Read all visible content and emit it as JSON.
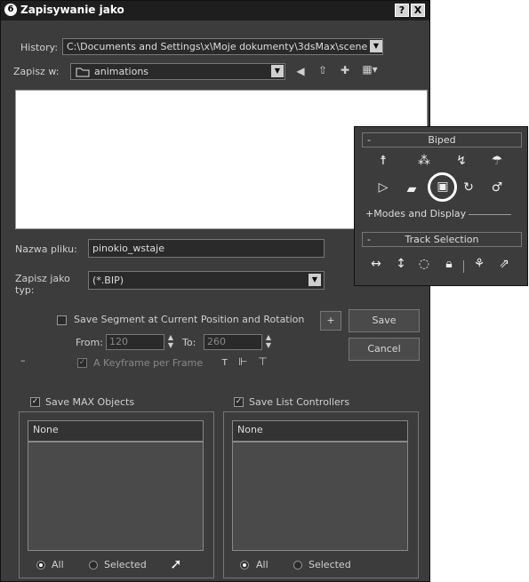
{
  "window": {
    "title": "Zapisywanie jako",
    "help_btn": "?",
    "close_btn": "X"
  },
  "history": {
    "label": "History:",
    "value": "C:\\Documents and Settings\\x\\Moje dokumenty\\3dsMax\\scene"
  },
  "save_in": {
    "label": "Zapisz w:",
    "value": "animations"
  },
  "filename": {
    "label": "Nazwa pliku:",
    "value": "pinokio_wstaje"
  },
  "filetype": {
    "label": "Zapisz jako typ:",
    "value": "(*.BIP)"
  },
  "segment": {
    "label": "Save Segment at Current Position and Rotation",
    "plus": "+",
    "from_label": "From:",
    "from_value": "120",
    "to_label": "To:",
    "to_value": "260",
    "keyframe_label": "A Keyframe per Frame",
    "minus": "–"
  },
  "buttons": {
    "save": "Save",
    "cancel": "Cancel"
  },
  "max_objects": {
    "label": "Save MAX Objects",
    "list_header": "None",
    "radio_all": "All",
    "radio_selected": "Selected"
  },
  "list_controllers": {
    "label": "Save List Controllers",
    "list_header": "None",
    "radio_all": "All",
    "radio_selected": "Selected"
  },
  "biped_panel": {
    "biped_title": "Biped",
    "biped_minus": "-",
    "modes_label": "+Modes and Display",
    "track_title": "Track Selection",
    "track_minus": "-"
  },
  "icons": [
    "back-icon",
    "up-folder-icon",
    "new-folder-icon",
    "view-menu-icon",
    "folder-icon",
    "key-filter-icons",
    "pick-icon"
  ]
}
